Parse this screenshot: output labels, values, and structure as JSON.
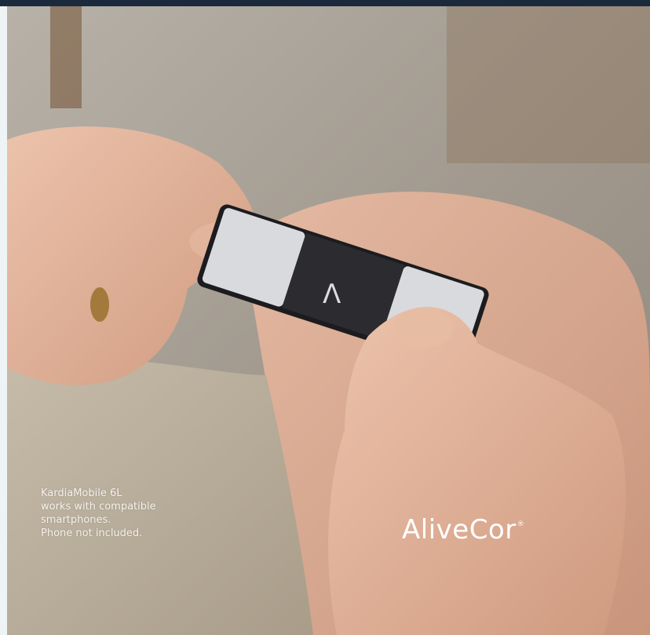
{
  "caption": {
    "line1": "KardiaMobile 6L",
    "line2": "works with compatible",
    "line3": "smartphones.",
    "line4": "Phone not included."
  },
  "logo": {
    "text": "AliveCor",
    "registered_mark": "®"
  },
  "device": {
    "glyph": "Λ"
  },
  "colors": {
    "top_bar": "#1a2a3c",
    "left_strip": "#eef3f5",
    "caption_text": "#f4f1ec",
    "logo_text": "#ffffff",
    "device_center": "#2b2b30",
    "device_pads": "#d9dadd"
  }
}
